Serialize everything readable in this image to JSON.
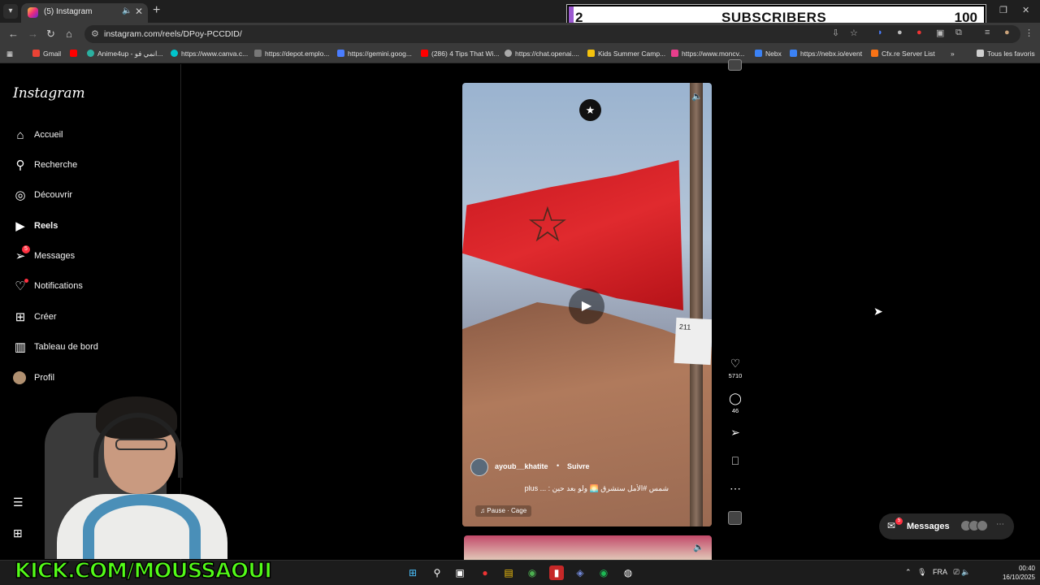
{
  "browser": {
    "tab": {
      "title": "(5) Instagram"
    },
    "url": "instagram.com/reels/DPoy-PCCDID/",
    "bookmarks": [
      {
        "label": "Gmail",
        "color": "#ea4335"
      },
      {
        "label": "",
        "color": "#ff0000"
      },
      {
        "label": "Anime4up - انمي فو...",
        "color": "#2bb0a0"
      },
      {
        "label": "https://www.canva.c...",
        "color": "#00c4cc"
      },
      {
        "label": "https://depot.emplo...",
        "color": "#777777"
      },
      {
        "label": "https://gemini.goog...",
        "color": "#4a7dff"
      },
      {
        "label": "(286) 4 Tips That Wi...",
        "color": "#ff0000"
      },
      {
        "label": "https://chat.openai....",
        "color": "#aaaaaa"
      },
      {
        "label": "Kids Summer Camp...",
        "color": "#f4c20d"
      },
      {
        "label": "https://www.moncv...",
        "color": "#e83e8c"
      },
      {
        "label": "Nebx",
        "color": "#3b82f6"
      },
      {
        "label": "https://nebx.io/event",
        "color": "#3b82f6"
      },
      {
        "label": "Cfx.re Server List",
        "color": "#f97316"
      }
    ],
    "all_bookmarks": "Tous les favoris"
  },
  "overlay": {
    "subscribers_count": "2",
    "subscribers_label": "SUBSCRIBERS",
    "subscribers_goal": "100"
  },
  "instagram": {
    "logo": "Instagram",
    "nav": [
      {
        "label": "Accueil",
        "icon": "home-icon"
      },
      {
        "label": "Recherche",
        "icon": "search-icon"
      },
      {
        "label": "Découvrir",
        "icon": "compass-icon"
      },
      {
        "label": "Reels",
        "icon": "reels-icon"
      },
      {
        "label": "Messages",
        "icon": "messenger-icon",
        "badge": "5"
      },
      {
        "label": "Notifications",
        "icon": "heart-icon"
      },
      {
        "label": "Créer",
        "icon": "plus-square-icon"
      },
      {
        "label": "Tableau de bord",
        "icon": "bar-chart-icon"
      },
      {
        "label": "Profil",
        "icon": "avatar"
      }
    ],
    "reel": {
      "author": "ayoub__khatite",
      "separator": "•",
      "follow": "Suivre",
      "caption": "شمس #الأمل ستشرق 🌅 ولو بعد حين : ... plus",
      "music": "Pause · Cage",
      "sign_text": "211"
    },
    "actions": {
      "likes": "5710",
      "comments": "46"
    },
    "messages_pill": {
      "label": "Messages",
      "badge": "5"
    }
  },
  "stream": {
    "kick_banner": "KICK.COM/MOUSSAOUI"
  },
  "taskbar": {
    "language": "FRA",
    "time": "00:40",
    "date": "16/10/2025"
  }
}
